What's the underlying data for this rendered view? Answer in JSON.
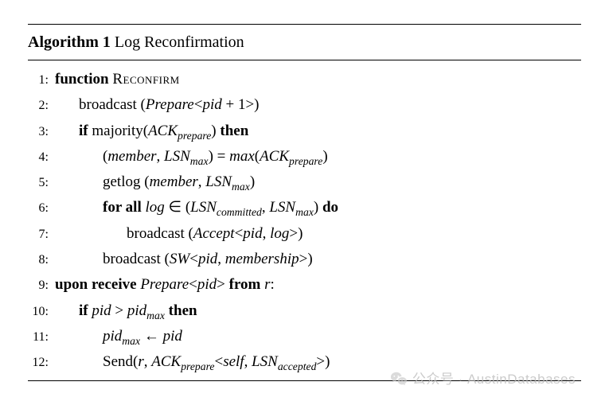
{
  "algorithm": {
    "number": "1",
    "title_prefix": "Algorithm",
    "title_name": "Log Reconfirmation",
    "lines": [
      {
        "n": "1:",
        "indent": 0,
        "html": "<span class='kw'>function</span> <span class='fn'>Reconfirm</span>"
      },
      {
        "n": "2:",
        "indent": 1,
        "html": "broadcast (<span class='it'>Prepare</span>&lt;<span class='it'>pid</span> + 1&gt;)"
      },
      {
        "n": "3:",
        "indent": 1,
        "html": "<span class='kw'>if</span> majority(<span class='it'>ACK</span><span class='sub'>prepare</span>) <span class='kw'>then</span>"
      },
      {
        "n": "4:",
        "indent": 2,
        "html": "(<span class='it'>member</span>, <span class='it'>LSN</span><span class='sub'>max</span>) = <span class='it'>max</span>(<span class='it'>ACK</span><span class='sub'>prepare</span>)"
      },
      {
        "n": "5:",
        "indent": 2,
        "html": "getlog (<span class='it'>member</span>, <span class='it'>LSN</span><span class='sub'>max</span>)"
      },
      {
        "n": "6:",
        "indent": 2,
        "html": "<span class='kw'>for all</span> <span class='it'>log</span> ∈ (<span class='it'>LSN</span><span class='sub'>committed</span>, <span class='it'>LSN</span><span class='sub'>max</span>) <span class='kw'>do</span>"
      },
      {
        "n": "7:",
        "indent": 3,
        "html": "broadcast (<span class='it'>Accept</span>&lt;<span class='it'>pid</span>, <span class='it'>log</span>&gt;)"
      },
      {
        "n": "8:",
        "indent": 2,
        "html": "broadcast (<span class='it'>SW</span>&lt;<span class='it'>pid</span>, <span class='it'>membership</span>&gt;)"
      },
      {
        "n": "9:",
        "indent": 0,
        "html": "<span class='kw'>upon receive</span> <span class='it'>Prepare</span>&lt;<span class='it'>pid</span>&gt; <span class='kw'>from</span> <span class='it'>r</span>:"
      },
      {
        "n": "10:",
        "indent": 1,
        "html": "<span class='kw'>if</span> <span class='it'>pid</span> &gt; <span class='it'>pid</span><span class='sub'>max</span> <span class='kw'>then</span>"
      },
      {
        "n": "11:",
        "indent": 2,
        "html": "<span class='it'>pid</span><span class='sub'>max</span> ← <span class='it'>pid</span>"
      },
      {
        "n": "12:",
        "indent": 2,
        "html": "Send(<span class='it'>r</span>, <span class='it'>ACK</span><span class='sub'>prepare</span>&lt;<span class='it'>self</span>, <span class='it'>LSN</span><span class='sub'>accepted</span>&gt;)"
      }
    ]
  },
  "watermark": {
    "prefix": "公众号 · ",
    "name": "AustinDatabases"
  }
}
